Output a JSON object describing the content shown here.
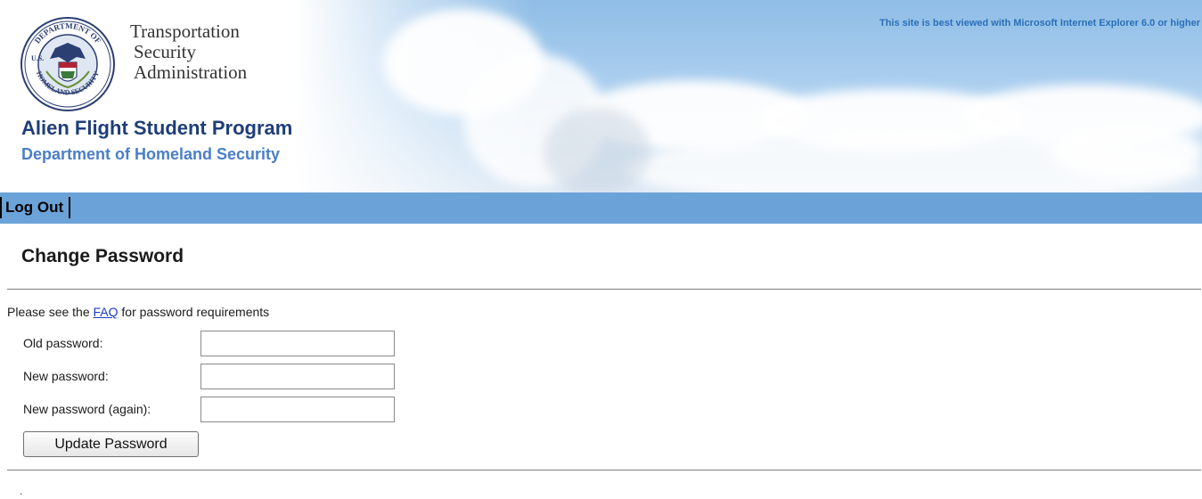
{
  "header": {
    "agency_lines": [
      "Transportation",
      "Security",
      "Administration"
    ],
    "seal_texts": {
      "top": "DEPARTMENT OF",
      "bottom": "HOMELAND SECURITY",
      "left": "U.S."
    },
    "program_title": "Alien Flight Student Program",
    "program_subtitle": "Department of Homeland Security",
    "browser_note": "This site is best viewed with Microsoft Internet Explorer 6.0 or higher"
  },
  "nav": {
    "logout_label": "Log Out"
  },
  "page": {
    "title": "Change Password",
    "requirements_prefix": "Please see the ",
    "faq_link": "FAQ",
    "requirements_suffix": " for password requirements",
    "fields": [
      {
        "label": "Old password:",
        "value": ""
      },
      {
        "label": "New password:",
        "value": ""
      },
      {
        "label": "New password (again):",
        "value": ""
      }
    ],
    "submit_label": "Update Password",
    "footer_mark": "."
  },
  "colors": {
    "navbar": "#6ba3d8",
    "program_title": "#1f3e7a",
    "program_subtitle": "#4a7fc6",
    "link": "#1a3ec0"
  },
  "icons": {
    "seal": "dhs-seal-icon"
  }
}
